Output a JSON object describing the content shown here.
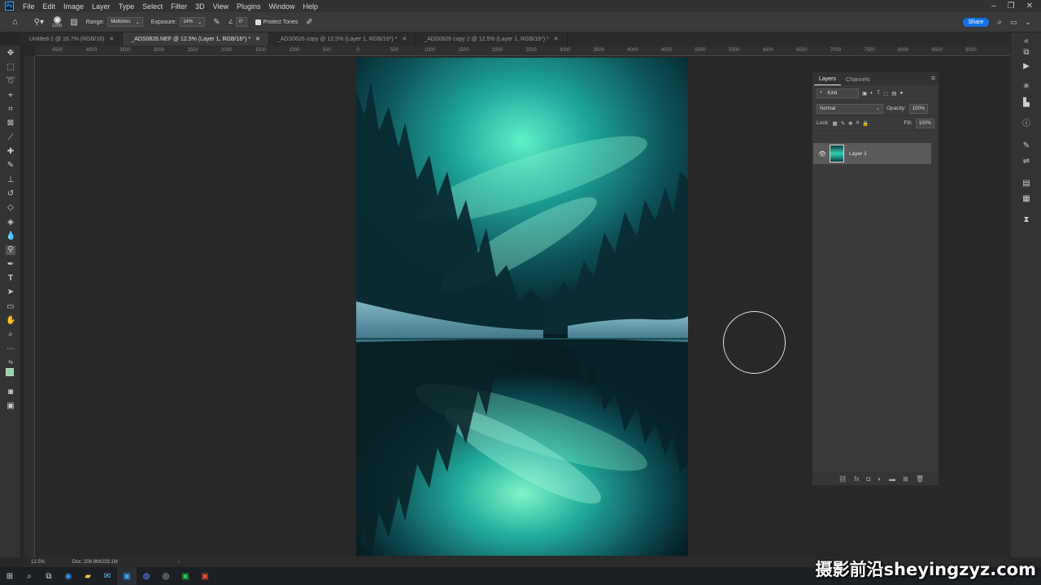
{
  "menubar": {
    "app_logo": "Ps",
    "items": [
      "File",
      "Edit",
      "Image",
      "Layer",
      "Type",
      "Select",
      "Filter",
      "3D",
      "View",
      "Plugins",
      "Window",
      "Help"
    ]
  },
  "options": {
    "brush_size": "1200",
    "range_label": "Range:",
    "range_value": "Midtones",
    "exposure_label": "Exposure:",
    "exposure_value": "14%",
    "angle_value": "0°",
    "protect_tones": "Protect Tones",
    "share": "Share"
  },
  "tabs": [
    {
      "label": "Untitled-1 @ 16.7% (RGB/16)"
    },
    {
      "label": "_ADS0626.NEF @ 12.5% (Layer 1, RGB/16*) *"
    },
    {
      "label": "_ADS0626 copy @ 12.5% (Layer 1, RGB/16*) *"
    },
    {
      "label": "_ADS0626 copy 2 @ 12.5% (Layer 1, RGB/16*) *"
    }
  ],
  "ruler": {
    "ticks": [
      "4500",
      "4000",
      "3500",
      "3000",
      "2500",
      "2000",
      "1500",
      "1000",
      "500",
      "0",
      "500",
      "1000",
      "1500",
      "2000",
      "2500",
      "3000",
      "3500",
      "4000",
      "4500",
      "5000",
      "5500",
      "6000",
      "6500",
      "7000",
      "7500",
      "8000",
      "8500",
      "9000"
    ]
  },
  "layers_panel": {
    "tabs": [
      "Layers",
      "Channels"
    ],
    "filter_kind": "Kind",
    "blend_mode": "Normal",
    "opacity_label": "Opacity:",
    "opacity_value": "100%",
    "lock_label": "Lock:",
    "fill_label": "Fill:",
    "fill_value": "100%",
    "layers": [
      {
        "name": "Layer 1"
      }
    ]
  },
  "status": {
    "zoom": "12.5%",
    "doc": "Doc: 206.9M/229.1M"
  },
  "watermark": "摄影前沿sheyingzyz.com"
}
